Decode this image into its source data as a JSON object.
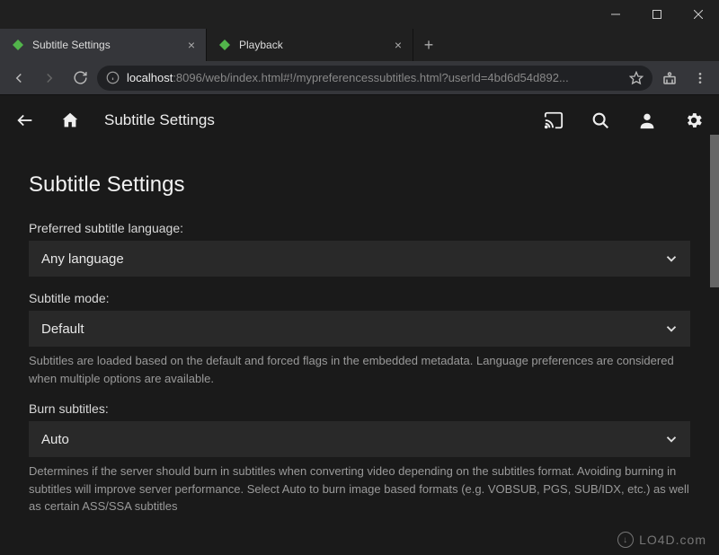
{
  "window": {
    "tabs": [
      {
        "title": "Subtitle Settings",
        "active": true
      },
      {
        "title": "Playback",
        "active": false
      }
    ],
    "address": {
      "protocol_icon": "info",
      "host": "localhost",
      "path": ":8096/web/index.html#!/mypreferencessubtitles.html?userId=4bd6d54d892..."
    }
  },
  "app_bar": {
    "title": "Subtitle Settings"
  },
  "page": {
    "heading": "Subtitle Settings",
    "fields": {
      "preferred_language": {
        "label": "Preferred subtitle language:",
        "value": "Any language"
      },
      "subtitle_mode": {
        "label": "Subtitle mode:",
        "value": "Default",
        "hint": "Subtitles are loaded based on the default and forced flags in the embedded metadata. Language preferences are considered when multiple options are available."
      },
      "burn_subtitles": {
        "label": "Burn subtitles:",
        "value": "Auto",
        "hint": "Determines if the server should burn in subtitles when converting video depending on the subtitles format. Avoiding burning in subtitles will improve server performance. Select Auto to burn image based formats (e.g. VOBSUB, PGS, SUB/IDX, etc.) as well as certain ASS/SSA subtitles"
      }
    }
  },
  "watermark": "LO4D.com"
}
